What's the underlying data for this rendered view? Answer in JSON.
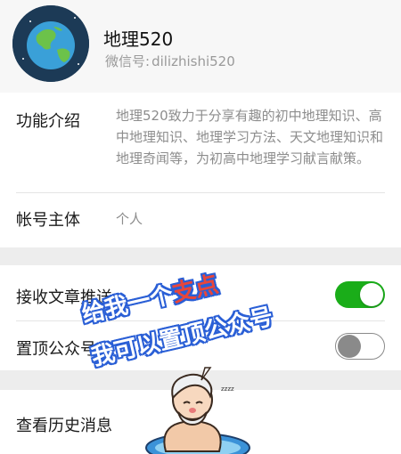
{
  "header": {
    "account_name": "地理520",
    "wechat_id_label": "微信号:",
    "wechat_id": "dilizhishi520"
  },
  "info": {
    "intro_label": "功能介绍",
    "intro_text": "地理520致力于分享有趣的初中地理知识、高中地理知识、地理学习方法、天文地理知识和地理奇闻等，为初高中地理学习献言献策。",
    "owner_label": "帐号主体",
    "owner_value": "个人"
  },
  "settings": {
    "receive_label": "接收文章推送",
    "receive_on": true,
    "pin_label": "置顶公众号",
    "pin_on": false
  },
  "history": {
    "label": "查看历史消息"
  },
  "overlay": {
    "line1_prefix": "给我一个",
    "line1_highlight": "支点",
    "line2": "我可以置顶公众号",
    "zzz": "zzzz"
  },
  "colors": {
    "toggle_on": "#1aad19",
    "stamp_outline": "#2a5fd6",
    "stamp_highlight": "#e8463a"
  }
}
